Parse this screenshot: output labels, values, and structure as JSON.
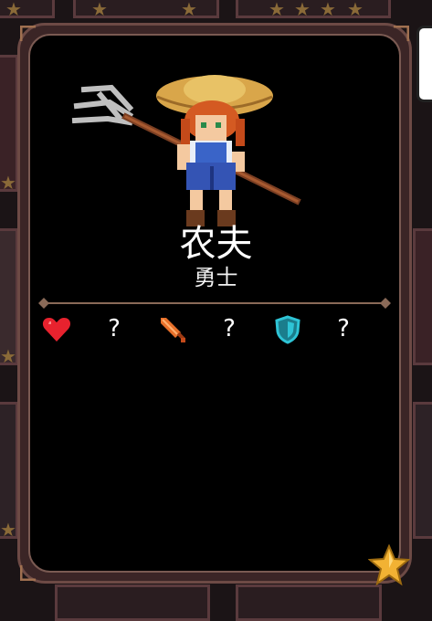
{
  "hero": {
    "name": "农夫",
    "class": "勇士"
  },
  "stats": [
    {
      "icon": "heart-icon",
      "value": "?",
      "color": "#e8222e"
    },
    {
      "icon": "sword-icon",
      "value": "?",
      "color": "#e8702a"
    },
    {
      "icon": "shield-icon",
      "value": "?",
      "color": "#2ec4d6"
    }
  ],
  "rarity": {
    "stars": 1,
    "icon": "star-icon",
    "color": "#f2b233"
  }
}
